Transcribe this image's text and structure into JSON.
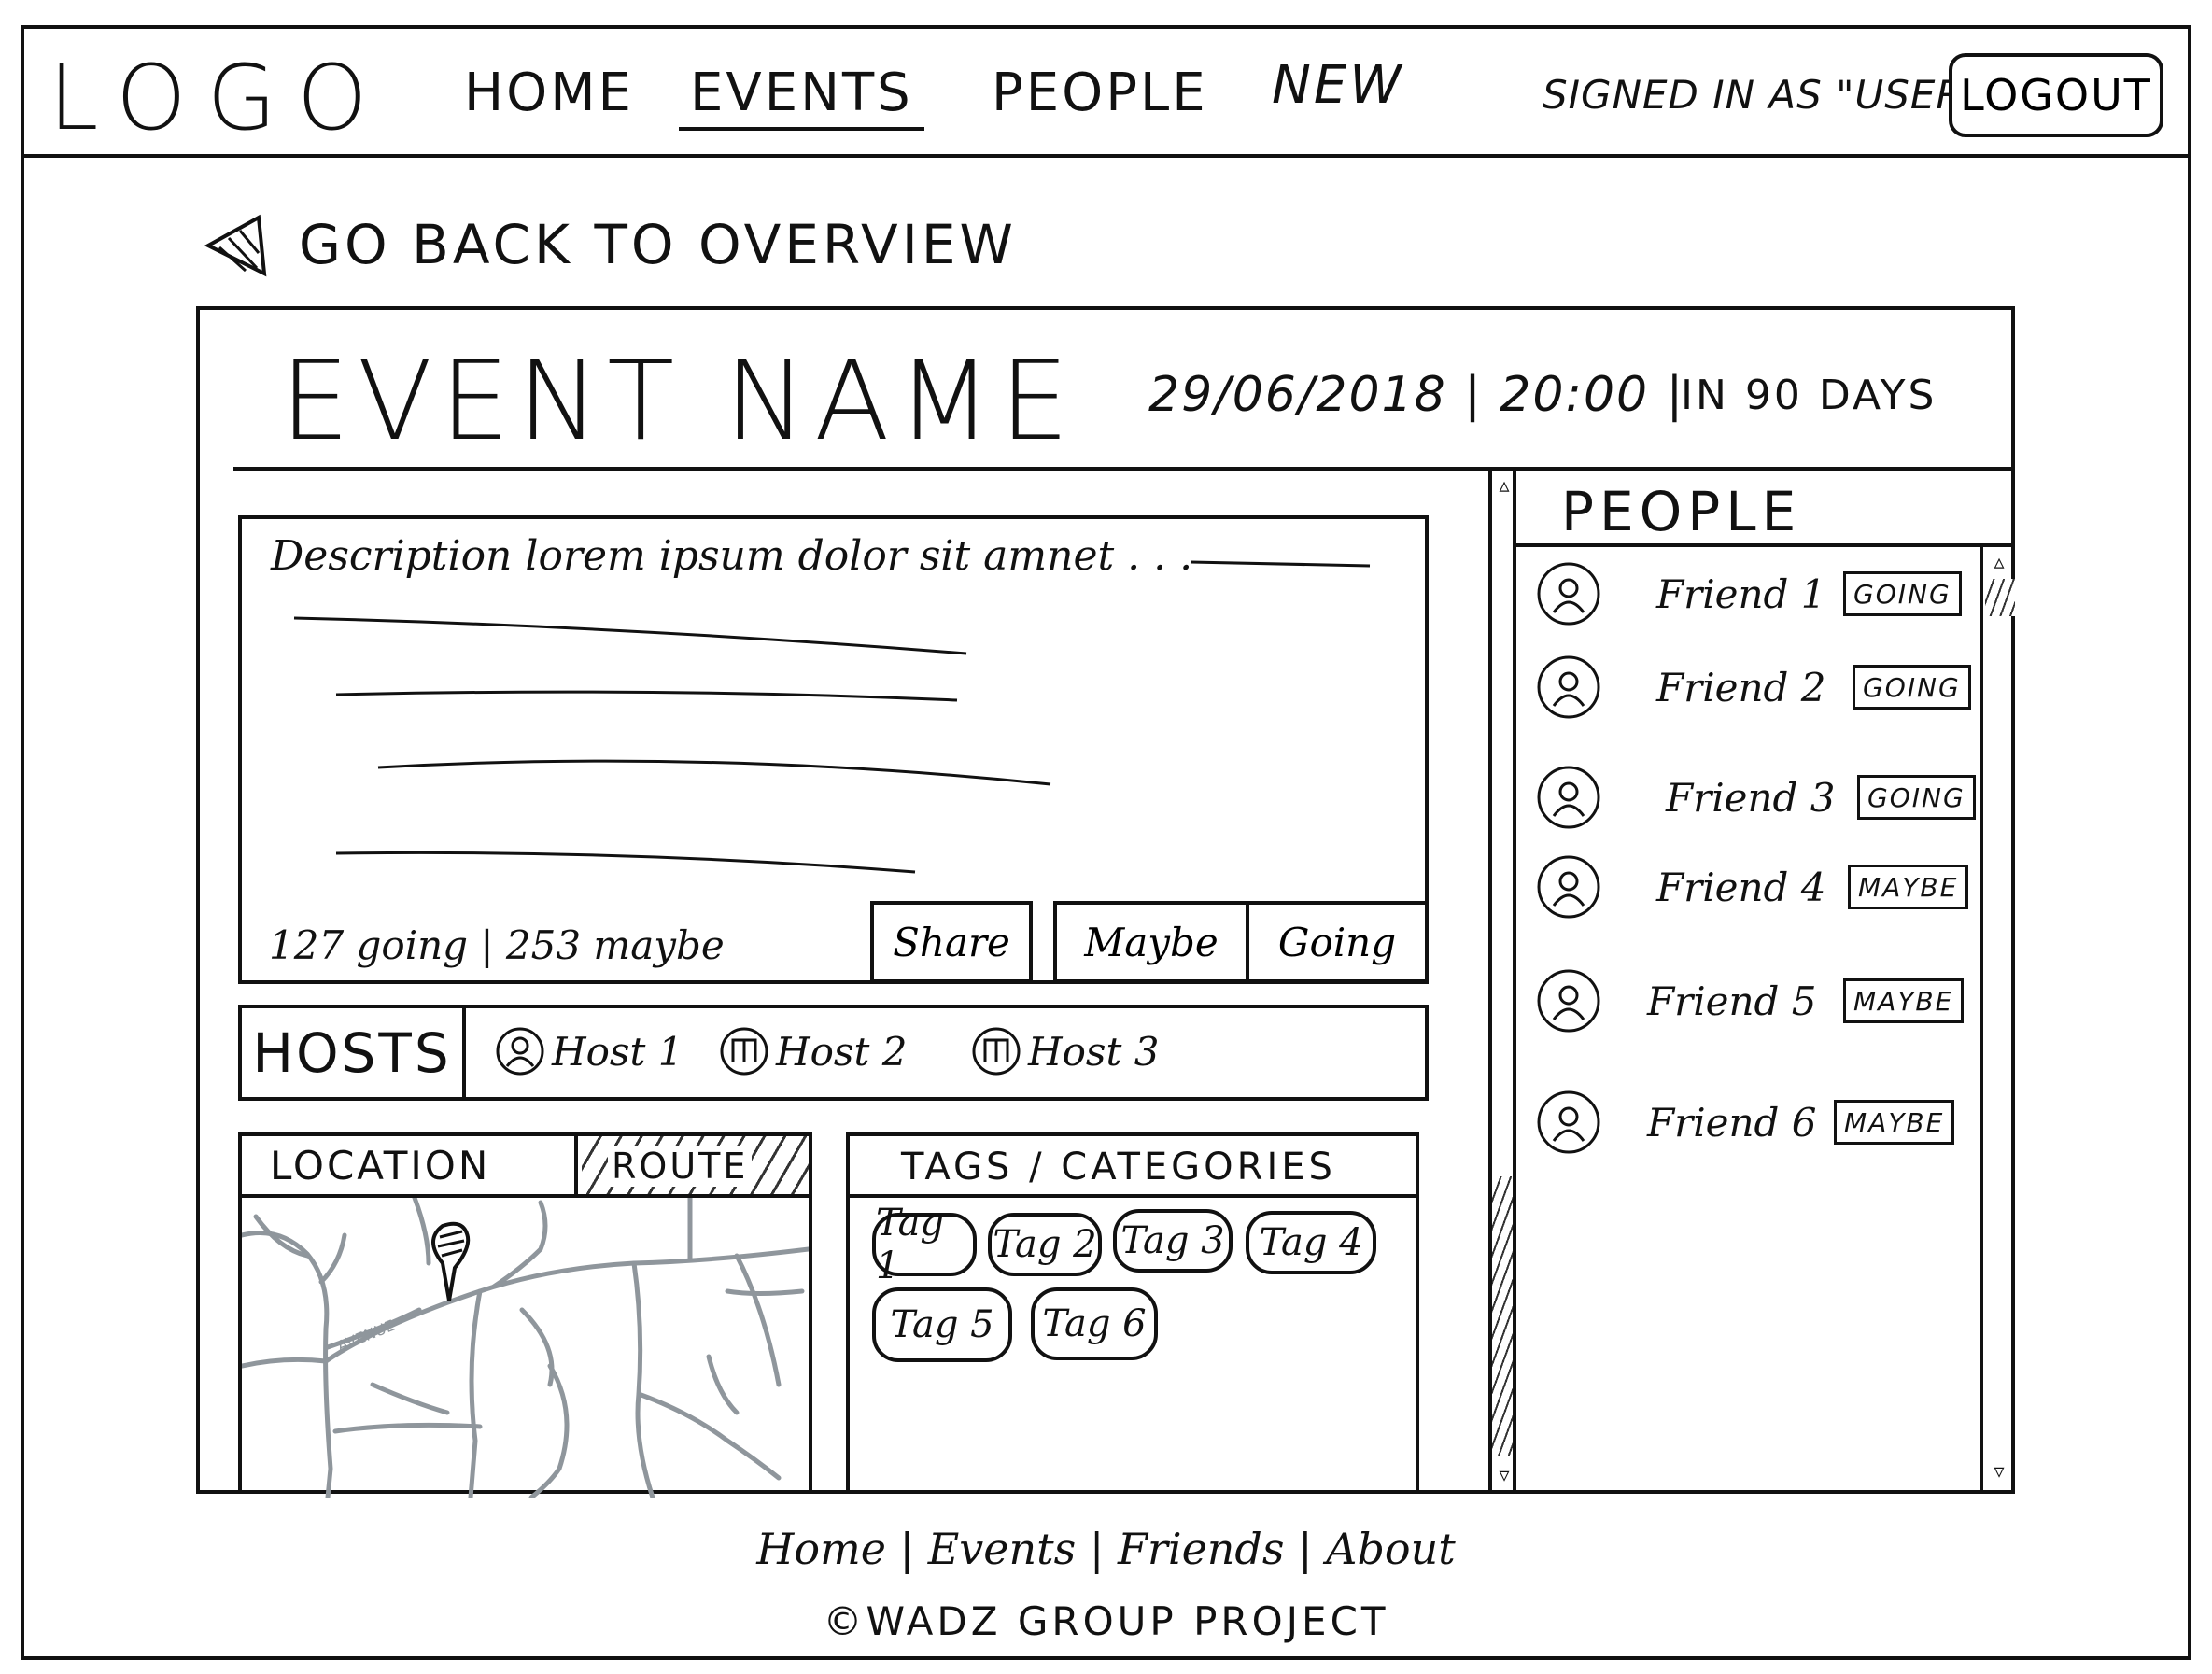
{
  "header": {
    "logo": "LOGO",
    "nav": [
      {
        "label": "HOME"
      },
      {
        "label": "EVENTS"
      },
      {
        "label": "PEOPLE"
      },
      {
        "label": "NEW"
      }
    ],
    "signed_in": "SIGNED IN AS \"USER\"",
    "logout_label": "LOGOUT"
  },
  "back_link": "GO BACK TO OVERVIEW",
  "event": {
    "name": "EVENT NAME",
    "datetime": "29/06/2018 | 20:00 |",
    "countdown": "IN  90 DAYS",
    "description": "Description   lorem  ipsum  dolor  sit  amnet . . .",
    "stats": "127 going  | 253  maybe",
    "actions": {
      "share": "Share",
      "maybe": "Maybe",
      "going": "Going"
    }
  },
  "hosts": {
    "label": "HOSTS",
    "items": [
      {
        "name": "Host 1"
      },
      {
        "name": "Host 2"
      },
      {
        "name": "Host 3"
      }
    ]
  },
  "location": {
    "tab_location": "LOCATION",
    "tab_route": "ROUTE",
    "street": "AVENUE"
  },
  "tags": {
    "header": "TAGS / CATEGORIES",
    "items": [
      "Tag 1",
      "Tag 2",
      "Tag 3",
      "Tag 4",
      "Tag 5",
      "Tag 6"
    ]
  },
  "people": {
    "header": "PEOPLE",
    "items": [
      {
        "name": "Friend 1",
        "status": "GOING"
      },
      {
        "name": "Friend 2",
        "status": "GOING"
      },
      {
        "name": "Friend 3",
        "status": "GOING"
      },
      {
        "name": "Friend 4",
        "status": "MAYBE"
      },
      {
        "name": "Friend 5",
        "status": "MAYBE"
      },
      {
        "name": "Friend 6",
        "status": "MAYBE"
      }
    ]
  },
  "footer": {
    "links": [
      {
        "label": "Home"
      },
      {
        "label": "Events"
      },
      {
        "label": "Friends"
      },
      {
        "label": "About"
      }
    ],
    "separator": " | ",
    "copyright": "©WADZ  GROUP PROJECT"
  }
}
